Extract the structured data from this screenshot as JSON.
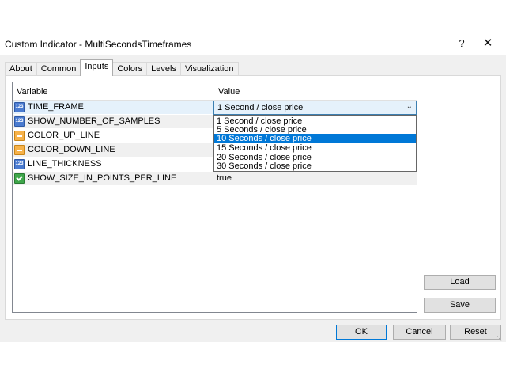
{
  "window": {
    "title": "Custom Indicator - MultiSecondsTimeframes",
    "help_label": "?",
    "close_label": "✕"
  },
  "tabs": [
    {
      "label": "About"
    },
    {
      "label": "Common"
    },
    {
      "label": "Inputs"
    },
    {
      "label": "Colors"
    },
    {
      "label": "Levels"
    },
    {
      "label": "Visualization"
    }
  ],
  "active_tab": "Inputs",
  "grid": {
    "headers": {
      "variable": "Variable",
      "value": "Value"
    },
    "rows": [
      {
        "name": "TIME_FRAME",
        "value": "1 Second / close price",
        "icon": "number-icon"
      },
      {
        "name": "SHOW_NUMBER_OF_SAMPLES",
        "value": "",
        "icon": "number-icon"
      },
      {
        "name": "COLOR_UP_LINE",
        "value": "",
        "icon": "color-icon"
      },
      {
        "name": "COLOR_DOWN_LINE",
        "value": "",
        "icon": "color-icon"
      },
      {
        "name": "LINE_THICKNESS",
        "value": "",
        "icon": "number-icon"
      },
      {
        "name": "SHOW_SIZE_IN_POINTS_PER_LINE",
        "value": "true",
        "icon": "bool-icon"
      }
    ]
  },
  "dropdown": {
    "selected_text": "1 Second / close price",
    "options": [
      "1 Second / close price",
      "5 Seconds / close price",
      "10 Seconds / close price",
      "15 Seconds / close price",
      "20 Seconds / close price",
      "30 Seconds / close price"
    ],
    "highlighted": "10 Seconds / close price"
  },
  "buttons": {
    "load": "Load",
    "save": "Save",
    "ok": "OK",
    "cancel": "Cancel",
    "reset": "Reset"
  },
  "colors": {
    "accent": "#0078d7",
    "dialog_bg": "#f0f0f0",
    "combo_bg": "#e5f1fb"
  }
}
